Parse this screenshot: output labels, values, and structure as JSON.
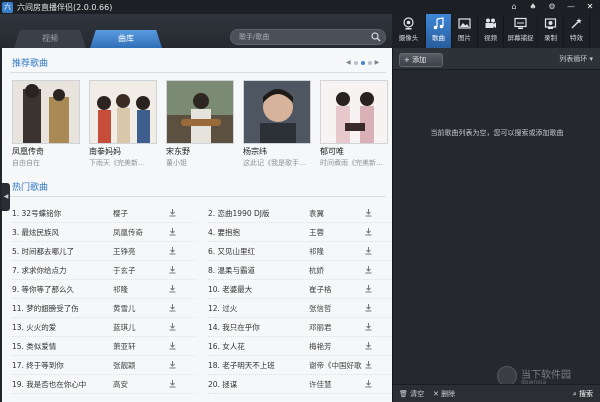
{
  "app": {
    "title": "六间房直播伴侣(2.0.0.66)"
  },
  "left_tabs": [
    {
      "label": "视频",
      "active": false
    },
    {
      "label": "曲库",
      "active": true
    }
  ],
  "search": {
    "placeholder": "歌手/歌曲"
  },
  "recommended": {
    "title": "推荐歌曲",
    "albums": [
      {
        "title": "凤凰传奇",
        "subtitle": "自由自在"
      },
      {
        "title": "南拳妈妈",
        "subtitle": "下雨天《完美新…"
      },
      {
        "title": "宋东野",
        "subtitle": "董小姐"
      },
      {
        "title": "杨宗纬",
        "subtitle": "这此记《我是歌手…"
      },
      {
        "title": "郁可唯",
        "subtitle": "时间煮雨《完美新…"
      }
    ]
  },
  "hot": {
    "title": "热门歌曲",
    "songs": [
      {
        "title": "1. 32号蝶铭你",
        "artist": "樱子"
      },
      {
        "title": "2. 恋曲1990 DJ版",
        "artist": "袁翼"
      },
      {
        "title": "3. 最炫民族风",
        "artist": "凤凰传奇"
      },
      {
        "title": "4. 要抱抱",
        "artist": "王蓉"
      },
      {
        "title": "5. 时间都去哪儿了",
        "artist": "王铮亮"
      },
      {
        "title": "6. 又见山里红",
        "artist": "祁隆"
      },
      {
        "title": "7. 求求你给点力",
        "artist": "于玄子"
      },
      {
        "title": "8. 温柔与霸道",
        "artist": "杭娇"
      },
      {
        "title": "9. 等你等了那么久",
        "artist": "祁隆"
      },
      {
        "title": "10. 老婆最大",
        "artist": "崔子格"
      },
      {
        "title": "11. 梦的翅膀受了伤",
        "artist": "黄雪儿"
      },
      {
        "title": "12. 过火",
        "artist": "张信哲"
      },
      {
        "title": "13. 火火的爱",
        "artist": "蓝琪儿"
      },
      {
        "title": "14. 我只在乎你",
        "artist": "邓丽君"
      },
      {
        "title": "15. 类似爱情",
        "artist": "萧亚轩"
      },
      {
        "title": "16. 女人花",
        "artist": "梅艳芳"
      },
      {
        "title": "17. 终于等到你",
        "artist": "张靓颖"
      },
      {
        "title": "18. 老子明天不上班",
        "artist": "谢帝《中国好歌"
      },
      {
        "title": "19. 我是否也在你心中",
        "artist": "高安"
      },
      {
        "title": "20. 拯谋",
        "artist": "许佳慧"
      }
    ]
  },
  "right_tabs": [
    {
      "label": "摄像头",
      "icon": "camera-icon"
    },
    {
      "label": "歌曲",
      "icon": "music-note-icon",
      "active": true
    },
    {
      "label": "图片",
      "icon": "picture-icon"
    },
    {
      "label": "视频",
      "icon": "video-icon"
    },
    {
      "label": "屏幕捕捉",
      "icon": "screen-capture-icon"
    },
    {
      "label": "录制",
      "icon": "record-icon"
    },
    {
      "label": "特效",
      "icon": "effects-icon"
    }
  ],
  "playlist": {
    "add_label": "+ 添加",
    "loop_mode": "列表循环 ▾",
    "empty_message": "当前歌曲列表为空，您可以搜索或添加歌曲",
    "clear_label": "清空",
    "delete_label": "删除",
    "search_label": "搜索"
  },
  "watermark": {
    "text": "当下软件园",
    "sub": "downxia"
  }
}
